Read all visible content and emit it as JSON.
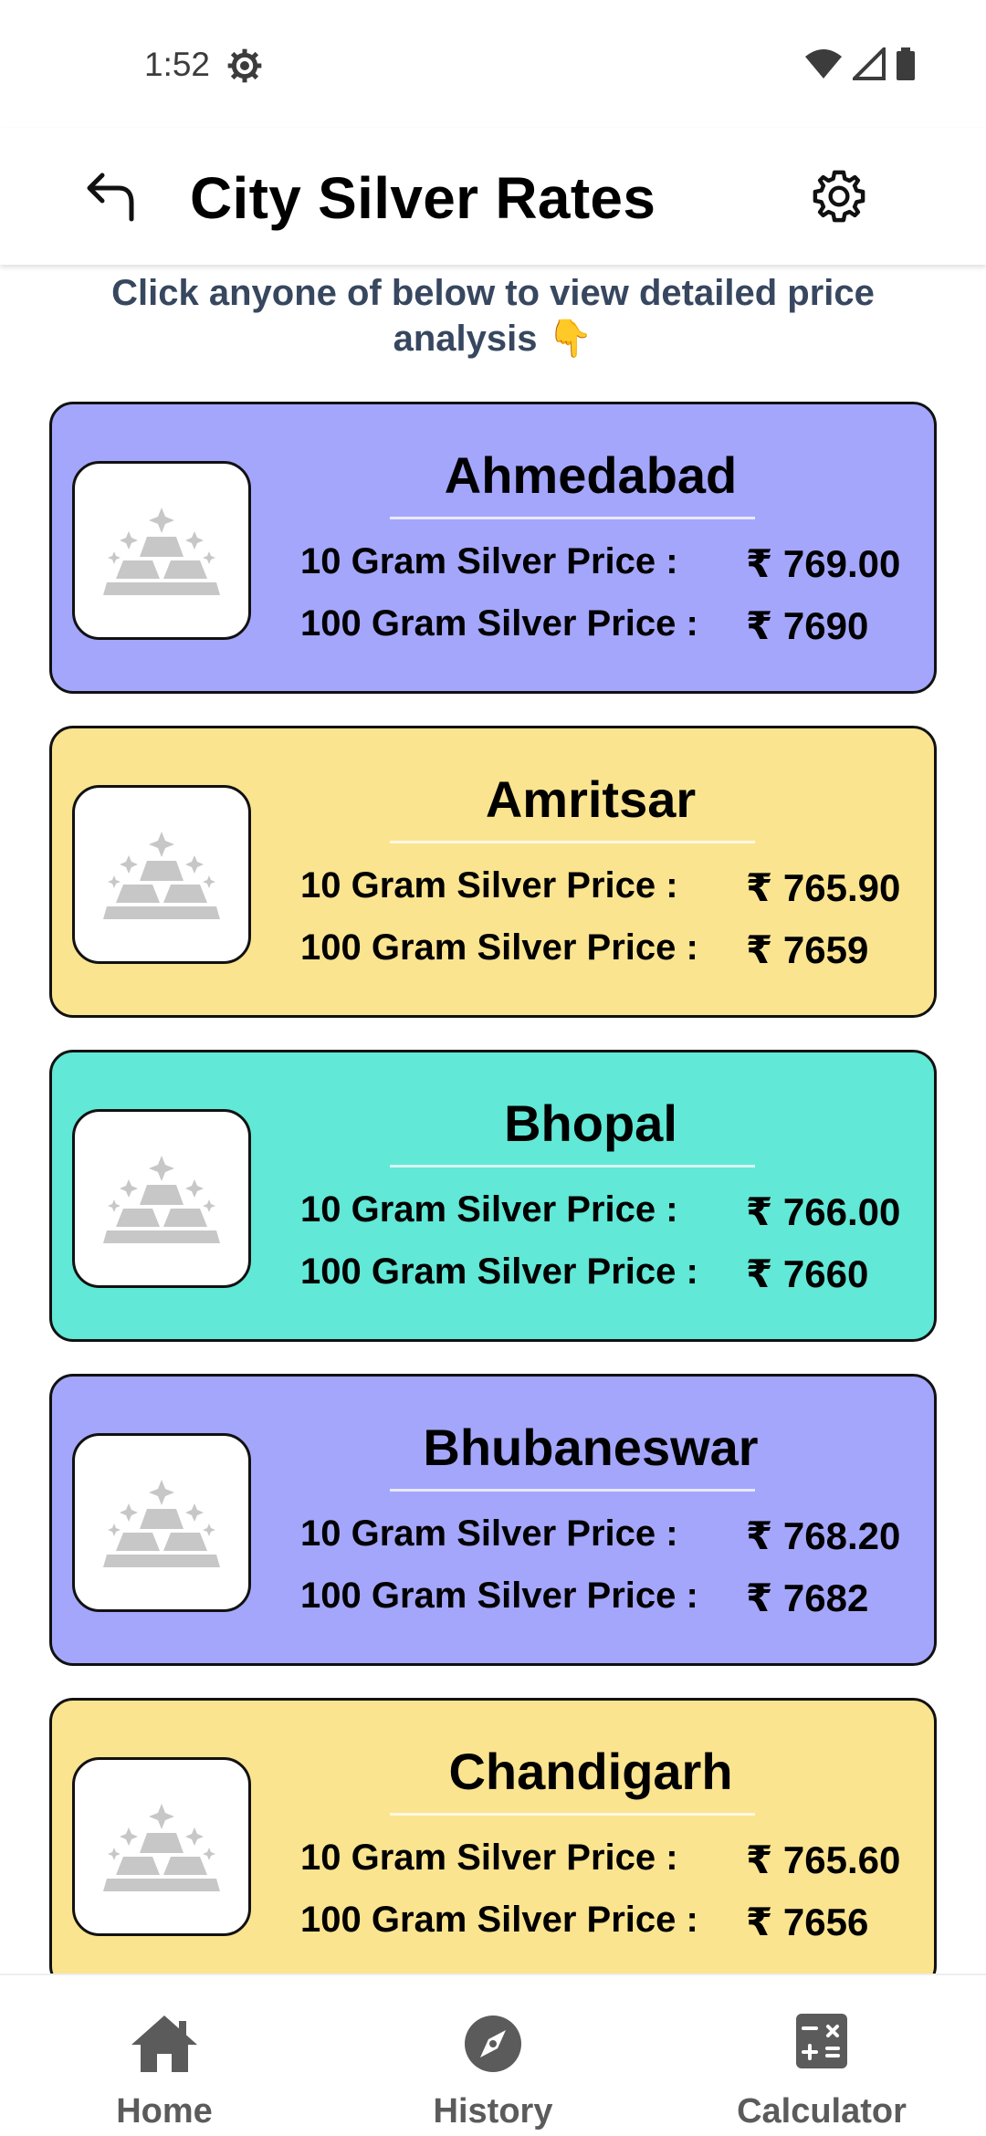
{
  "status_bar": {
    "time": "1:52"
  },
  "header": {
    "title": "City Silver Rates"
  },
  "subtitle": "Click anyone of below to view detailed price analysis 👇",
  "colors": {
    "purple": "#a4a6fb",
    "yellow": "#fbe48f",
    "teal": "#61e8d6"
  },
  "cards": [
    {
      "city": "Ahmedabad",
      "label_10": "10 Gram Silver Price :",
      "price_10": "₹ 769.00",
      "label_100": "100 Gram Silver Price :",
      "price_100": "₹ 7690",
      "color": "#a4a6fb"
    },
    {
      "city": "Amritsar",
      "label_10": "10 Gram Silver Price :",
      "price_10": "₹ 765.90",
      "label_100": "100 Gram Silver Price :",
      "price_100": "₹ 7659",
      "color": "#fbe48f"
    },
    {
      "city": "Bhopal",
      "label_10": "10 Gram Silver Price :",
      "price_10": "₹ 766.00",
      "label_100": "100 Gram Silver Price :",
      "price_100": "₹ 7660",
      "color": "#61e8d6"
    },
    {
      "city": "Bhubaneswar",
      "label_10": "10 Gram Silver Price :",
      "price_10": "₹ 768.20",
      "label_100": "100 Gram Silver Price :",
      "price_100": "₹ 7682",
      "color": "#a4a6fb"
    },
    {
      "city": "Chandigarh",
      "label_10": "10 Gram Silver Price :",
      "price_10": "₹ 765.60",
      "label_100": "100 Gram Silver Price :",
      "price_100": "₹ 7656",
      "color": "#fbe48f"
    }
  ],
  "nav": [
    {
      "label": "Home",
      "icon": "home-icon"
    },
    {
      "label": "History",
      "icon": "compass-icon"
    },
    {
      "label": "Calculator",
      "icon": "calculator-icon"
    }
  ]
}
